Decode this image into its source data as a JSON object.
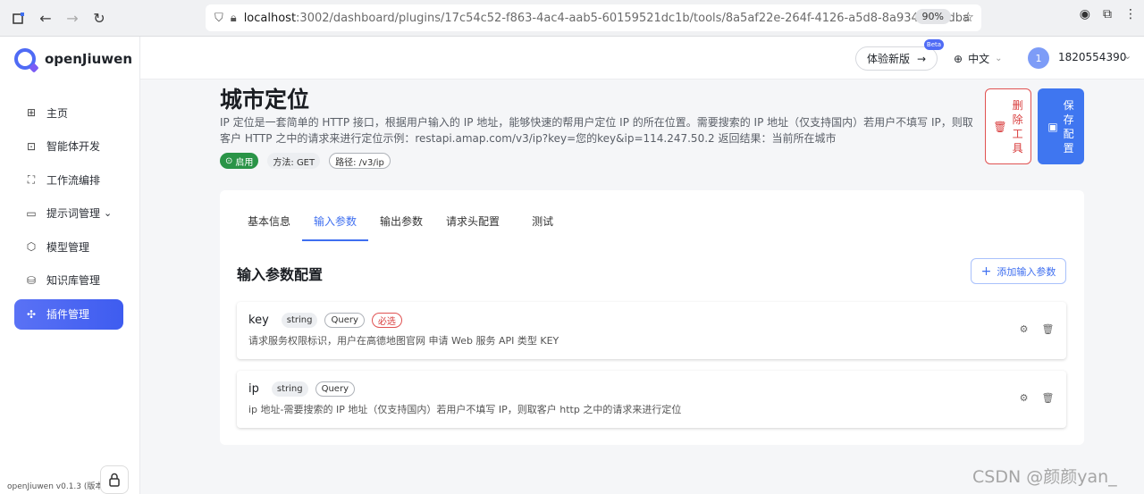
{
  "browser": {
    "url_host": "localhost",
    "url_path": ":3002/dashboard/plugins/17c54c52-f863-4ac4-aab5-60159521dc1b/tools/8a5af22e-264f-4126-a5d8-8a934ab3bdba",
    "zoom": "90%"
  },
  "app": {
    "name": "openJiuwen",
    "version": "openJiuwen v0.1.3 (版本"
  },
  "sidebar": {
    "items": [
      {
        "label": "主页",
        "icon": "grid-icon"
      },
      {
        "label": "智能体开发",
        "icon": "robot-icon"
      },
      {
        "label": "工作流编排",
        "icon": "workflow-icon"
      },
      {
        "label": "提示词管理",
        "icon": "chat-icon",
        "caret": "⌄"
      },
      {
        "label": "模型管理",
        "icon": "model-icon"
      },
      {
        "label": "知识库管理",
        "icon": "database-icon"
      },
      {
        "label": "插件管理",
        "icon": "puzzle-icon"
      }
    ]
  },
  "topbar": {
    "try_label": "体验新版",
    "beta": "Beta",
    "lang": "中文",
    "avatar_initial": "1",
    "username": "1820554390"
  },
  "tool": {
    "title": "城市定位",
    "description": "IP 定位是一套简单的 HTTP 接口，根据用户输入的 IP 地址，能够快速的帮用户定位 IP 的所在位置。需要搜索的 IP 地址（仅支持国内）若用户不填写 IP，则取客户 HTTP 之中的请求来进行定位示例：restapi.amap.com/v3/ip?key=您的key&ip=114.247.50.2 返回结果：当前所在城市",
    "status": "启用",
    "method": "方法: GET",
    "path": "路径: /v3/ip",
    "delete_label": [
      "删",
      "除",
      "工",
      "具"
    ],
    "save_label": [
      "保",
      "存",
      "配",
      "置"
    ]
  },
  "tabs": [
    "基本信息",
    "输入参数",
    "输出参数",
    "请求头配置",
    "测试"
  ],
  "section": {
    "title": "输入参数配置",
    "add_label": "添加输入参数"
  },
  "params": [
    {
      "name": "key",
      "type": "string",
      "location": "Query",
      "required": "必选",
      "desc": "请求服务权限标识，用户在高德地图官网 申请 Web 服务 API 类型 KEY"
    },
    {
      "name": "ip",
      "type": "string",
      "location": "Query",
      "required": "",
      "desc": "ip 地址-需要搜索的 IP 地址（仅支持国内）若用户不填写 IP，则取客户 http 之中的请求来进行定位"
    }
  ],
  "watermark": "CSDN @颜颜yan_"
}
